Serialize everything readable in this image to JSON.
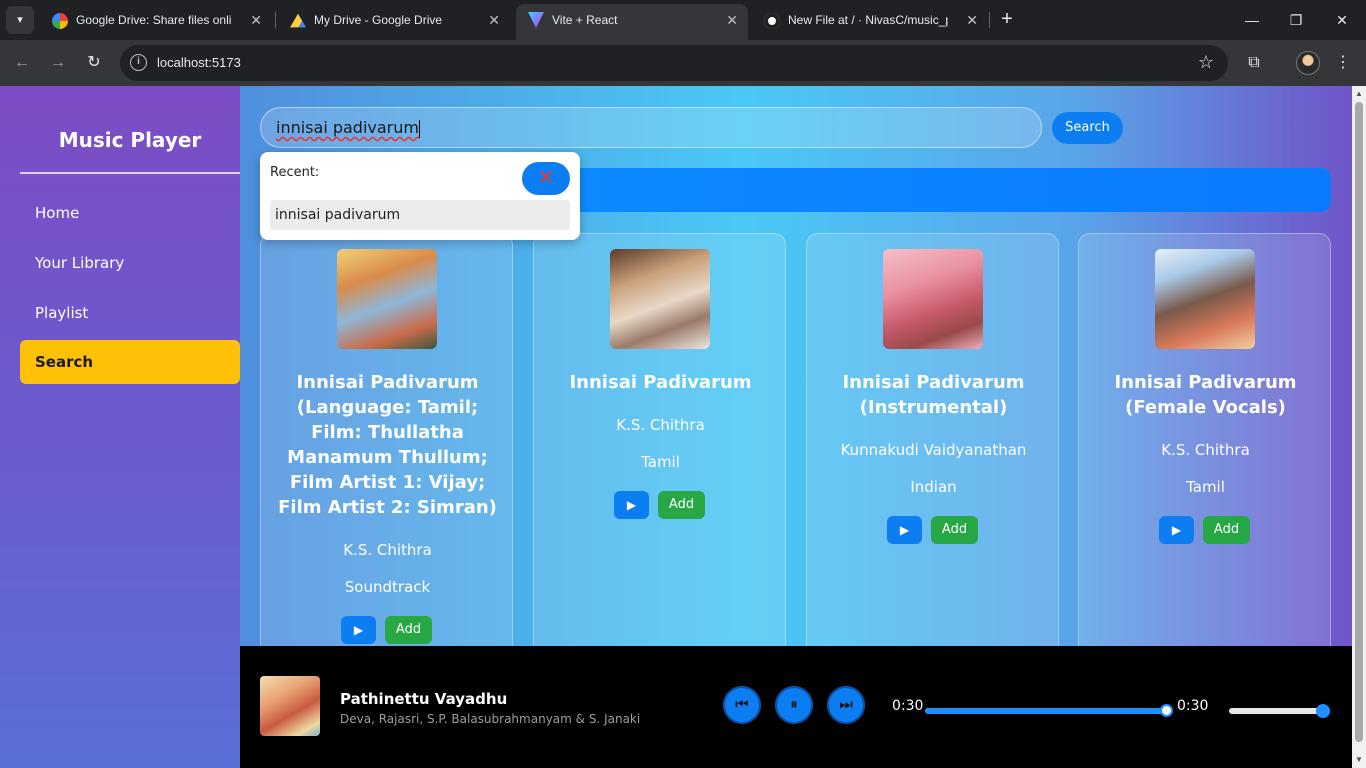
{
  "browser": {
    "tabs": [
      {
        "title": "Google Drive: Share files online",
        "icon": "google-icon"
      },
      {
        "title": "My Drive - Google Drive",
        "icon": "drive-icon"
      },
      {
        "title": "Vite + React",
        "icon": "vite-icon"
      },
      {
        "title": "New File at / · NivasC/music_pl",
        "icon": "github-icon"
      }
    ],
    "url": "localhost:5173"
  },
  "sidebar": {
    "title": "Music Player",
    "items": [
      {
        "label": "Home"
      },
      {
        "label": "Your Library"
      },
      {
        "label": "Playlist"
      },
      {
        "label": "Search"
      }
    ]
  },
  "search": {
    "query": "innisai padivarum",
    "button_label": "Search",
    "recent_label": "Recent:",
    "recent_items": [
      "innisai padivarum"
    ]
  },
  "results": [
    {
      "title": "Innisai Padivarum (Language: Tamil; Film: Thullatha Manamum Thullum; Film Artist 1: Vijay; Film Artist 2: Simran)",
      "artist": "K.S. Chithra",
      "genre": "Soundtrack",
      "add_label": "Add"
    },
    {
      "title": "Innisai Padivarum",
      "artist": "K.S. Chithra",
      "genre": "Tamil",
      "add_label": "Add"
    },
    {
      "title": "Innisai Padivarum (Instrumental)",
      "artist": "Kunnakudi Vaidyanathan",
      "genre": "Indian",
      "add_label": "Add"
    },
    {
      "title": "Innisai Padivarum (Female Vocals)",
      "artist": "K.S. Chithra",
      "genre": "Tamil",
      "add_label": "Add"
    }
  ],
  "player": {
    "title": "Pathinettu Vayadhu",
    "artist": "Deva, Rajasri, S.P. Balasubrahmanyam & S. Janaki",
    "current_time": "0:30",
    "duration": "0:30",
    "progress": 1.0,
    "volume": 1.0
  },
  "colors": {
    "accent": "#0d7df2",
    "active_nav": "#ffc107",
    "add_button": "#28a745"
  }
}
